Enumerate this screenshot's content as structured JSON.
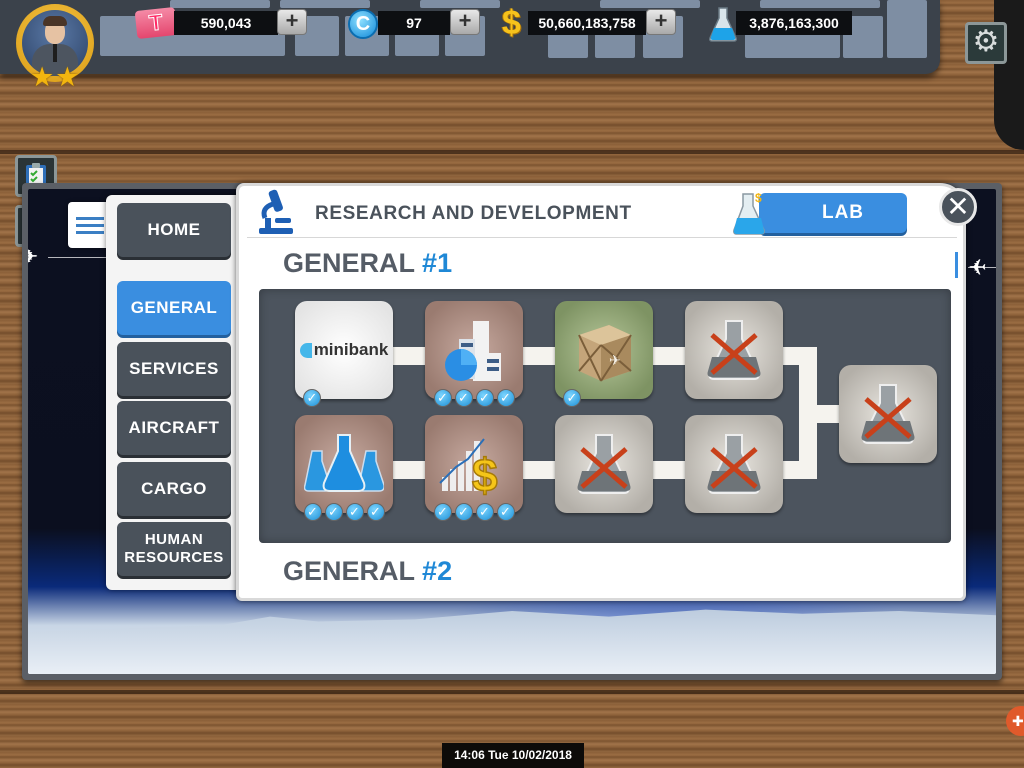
{
  "hud": {
    "player": {
      "stars": 2
    },
    "currencies": [
      {
        "id": "tickets",
        "icon": "ticket-icon",
        "value": "590,043",
        "has_add": true
      },
      {
        "id": "coins",
        "icon": "coin-icon",
        "value": "97",
        "has_add": true
      },
      {
        "id": "money",
        "icon": "dollar-icon",
        "value": "50,660,183,758",
        "has_add": true
      },
      {
        "id": "research_points",
        "icon": "flask-icon",
        "value": "3,876,163,300",
        "has_add": false
      }
    ],
    "add_symbol": "+",
    "settings_icon": "gear-icon"
  },
  "side_buttons": [
    {
      "name": "tasks",
      "icon": "clipboard-icon"
    },
    {
      "name": "finance",
      "icon": "dollar-speed-icon"
    }
  ],
  "menu": {
    "items": [
      {
        "label": "HOME",
        "active": false
      },
      {
        "label": "GENERAL",
        "active": true
      },
      {
        "label": "SERVICES",
        "active": false
      },
      {
        "label": "AIRCRAFT",
        "active": false
      },
      {
        "label": "CARGO",
        "active": false
      },
      {
        "label": "HUMAN RESOURCES",
        "active": false
      }
    ]
  },
  "dialog": {
    "title": "RESEARCH AND DEVELOPMENT",
    "lab_button": "LAB",
    "close_symbol": "✕",
    "sections": [
      {
        "title": "GENERAL",
        "number": "#1"
      },
      {
        "title": "GENERAL",
        "number": "#2"
      }
    ],
    "tree_nodes": [
      {
        "name": "minibank",
        "icon": "minibank-logo",
        "label": "minibank",
        "state": "researched",
        "levels_done": 1,
        "levels_total": 1
      },
      {
        "name": "business-analytics",
        "icon": "buildings-chart-icon",
        "state": "researched",
        "levels_done": 4,
        "levels_total": 4
      },
      {
        "name": "cargo-crate",
        "icon": "crate-icon",
        "state": "researched",
        "levels_done": 1,
        "levels_total": 1
      },
      {
        "name": "locked-top-4",
        "icon": "locked-flask-icon",
        "state": "locked"
      },
      {
        "name": "research-flasks",
        "icon": "flasks-icon",
        "state": "researched",
        "levels_done": 4,
        "levels_total": 4
      },
      {
        "name": "revenue-growth",
        "icon": "chart-dollar-icon",
        "state": "researched",
        "levels_done": 4,
        "levels_total": 4
      },
      {
        "name": "locked-bottom-3",
        "icon": "locked-flask-icon",
        "state": "locked"
      },
      {
        "name": "locked-bottom-4",
        "icon": "locked-flask-icon",
        "state": "locked"
      },
      {
        "name": "locked-final",
        "icon": "locked-flask-icon",
        "state": "locked"
      }
    ],
    "check_symbol": "✓"
  },
  "footer": {
    "datetime": "14:06 Tue 10/02/2018"
  },
  "colors": {
    "accent_blue": "#3a8ee0",
    "panel_dark": "#4a525b",
    "lock_red": "#c8401a"
  }
}
